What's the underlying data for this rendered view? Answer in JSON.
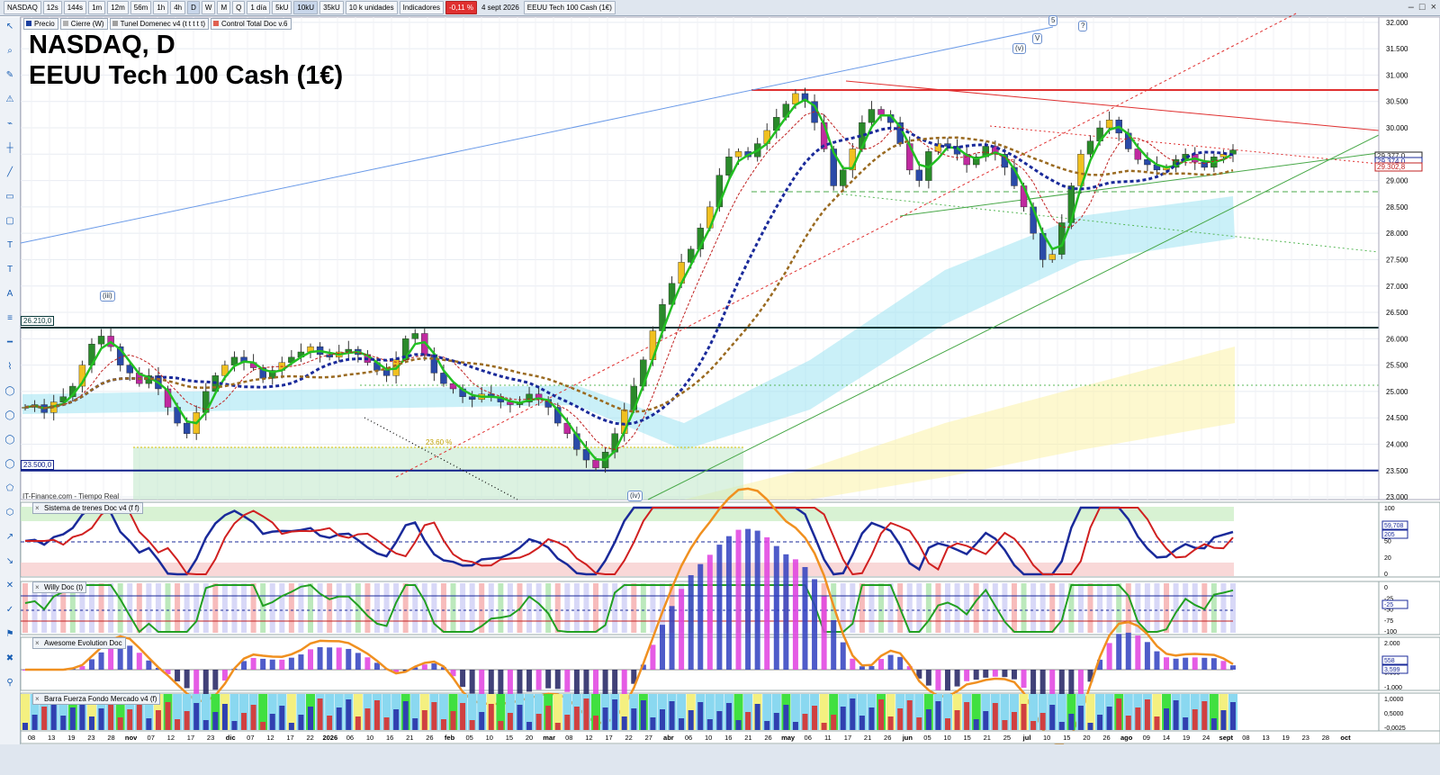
{
  "toolbar": {
    "symbol": "NASDAQ",
    "timeframes": [
      "12s",
      "144s",
      "1m",
      "12m",
      "56m",
      "1h",
      "4h",
      "D",
      "W",
      "M",
      "Q"
    ],
    "active_timeframe": "D",
    "period": "1 día",
    "ranges": [
      "5kU",
      "10kU",
      "35kU"
    ],
    "active_range": "10kU",
    "units": "10 k unidades",
    "indicators": "Indicadores",
    "change": "-0,11 %",
    "date": "4 sept 2026",
    "instrument": "EEUU Tech 100 Cash (1€)"
  },
  "overlays": [
    {
      "label": "Precio",
      "color": "#1a3fa0"
    },
    {
      "label": "Cierre (W)",
      "color": "#b0b0b0"
    },
    {
      "label": "Tunel Domenec v4 (t t t t t)",
      "color": "#a0a0a0"
    },
    {
      "label": "Control Total Doc v.6",
      "color": "#e06050"
    }
  ],
  "chart_header": {
    "line1": "NASDAQ, D",
    "line2": "EEUU Tech 100 Cash (1€)"
  },
  "source_label": "IT-Finance.com - Tiempo Real",
  "levels": [
    {
      "label": "26.210,0",
      "value": 26210,
      "color": "#0a3a3a"
    },
    {
      "label": "23.500,0",
      "value": 23500,
      "color": "#10208a"
    }
  ],
  "fib_label": "23.60 %",
  "wave_labels": [
    "(iii)",
    "(iv)",
    "(v)",
    "V",
    "5",
    "?"
  ],
  "price_readouts": [
    "29.302,8",
    "29.374,0",
    "29.377,0"
  ],
  "panels": [
    {
      "title": "Sistema de trenes Doc v4 (f f)",
      "axis": [
        "100",
        "80",
        "50",
        "20",
        "0"
      ],
      "readouts": [
        "59,708",
        "205"
      ]
    },
    {
      "title": "Willy Doc (t)",
      "axis": [
        "0",
        "-25",
        "-50",
        "-75",
        "-100"
      ],
      "readouts": [
        "-25"
      ]
    },
    {
      "title": "Awesome Evolution Doc",
      "axis": [
        "2.000",
        "1.000",
        "0.000",
        "-1.000"
      ],
      "readouts": [
        "558",
        "3,599"
      ]
    },
    {
      "title": "Barra Fuerza Fondo Mercado v4 (f)",
      "axis": [
        "1,0000",
        "0,5000",
        "-0,0025"
      ],
      "readouts": []
    }
  ],
  "chart_data": {
    "type": "candlestick",
    "title": "NASDAQ, D",
    "subtitle": "EEUU Tech 100 Cash (1€)",
    "y_axis_ticks": [
      23000,
      23500,
      24000,
      24500,
      25000,
      25500,
      26000,
      26500,
      27000,
      27500,
      28000,
      28500,
      29000,
      29500,
      30000,
      30500,
      31000,
      31500,
      32000
    ],
    "y_axis_labels": [
      "23.000",
      "23.500",
      "24.000",
      "24.500",
      "25.000",
      "25.500",
      "26.000",
      "26.500",
      "27.000",
      "27.500",
      "28.000",
      "28.500",
      "29.000",
      "29.500",
      "30.000",
      "30.500",
      "31.000",
      "31.500",
      "32.000"
    ],
    "ylim": [
      22950,
      32100
    ],
    "x_axis_labels": [
      "08",
      "13",
      "19",
      "23",
      "28",
      "nov",
      "07",
      "12",
      "17",
      "23",
      "dic",
      "07",
      "12",
      "17",
      "22",
      "2026",
      "06",
      "10",
      "16",
      "21",
      "26",
      "feb",
      "05",
      "10",
      "15",
      "20",
      "mar",
      "08",
      "12",
      "17",
      "22",
      "27",
      "abr",
      "06",
      "10",
      "16",
      "21",
      "26",
      "may",
      "06",
      "11",
      "17",
      "21",
      "26",
      "jun",
      "05",
      "10",
      "15",
      "21",
      "25",
      "jul",
      "10",
      "15",
      "20",
      "26",
      "ago",
      "09",
      "14",
      "19",
      "24",
      "sept",
      "08",
      "13",
      "19",
      "23",
      "28",
      "oct"
    ],
    "close_series": [
      24700,
      24750,
      24600,
      24800,
      24900,
      25100,
      25500,
      25900,
      26050,
      25850,
      25500,
      25350,
      25150,
      25300,
      25050,
      24700,
      24400,
      24200,
      24600,
      25000,
      25300,
      25500,
      25650,
      25550,
      25450,
      25250,
      25400,
      25550,
      25650,
      25750,
      25850,
      25700,
      25650,
      25750,
      25800,
      25700,
      25550,
      25400,
      25300,
      25600,
      26000,
      26100,
      25700,
      25350,
      25150,
      25050,
      24900,
      24850,
      24950,
      24900,
      24800,
      24750,
      24800,
      24950,
      24850,
      24700,
      24400,
      24200,
      23900,
      23700,
      23550,
      23850,
      24200,
      24650,
      25100,
      25600,
      26150,
      26650,
      27050,
      27450,
      27700,
      28100,
      28500,
      29100,
      29450,
      29550,
      29450,
      29700,
      29950,
      30200,
      30450,
      30650,
      30500,
      30100,
      29600,
      28900,
      29200,
      29600,
      30100,
      30350,
      30250,
      30100,
      29700,
      29200,
      29000,
      29550,
      29700,
      29650,
      29500,
      29300,
      29450,
      29650,
      29500,
      29250,
      28900,
      28500,
      28000,
      27500,
      27600,
      28200,
      28900,
      29500,
      29750,
      30000,
      30150,
      29900,
      29600,
      29400,
      29300,
      29200,
      29250,
      29400,
      29500,
      29350,
      29250,
      29450,
      29500,
      29580
    ],
    "grid": true
  }
}
